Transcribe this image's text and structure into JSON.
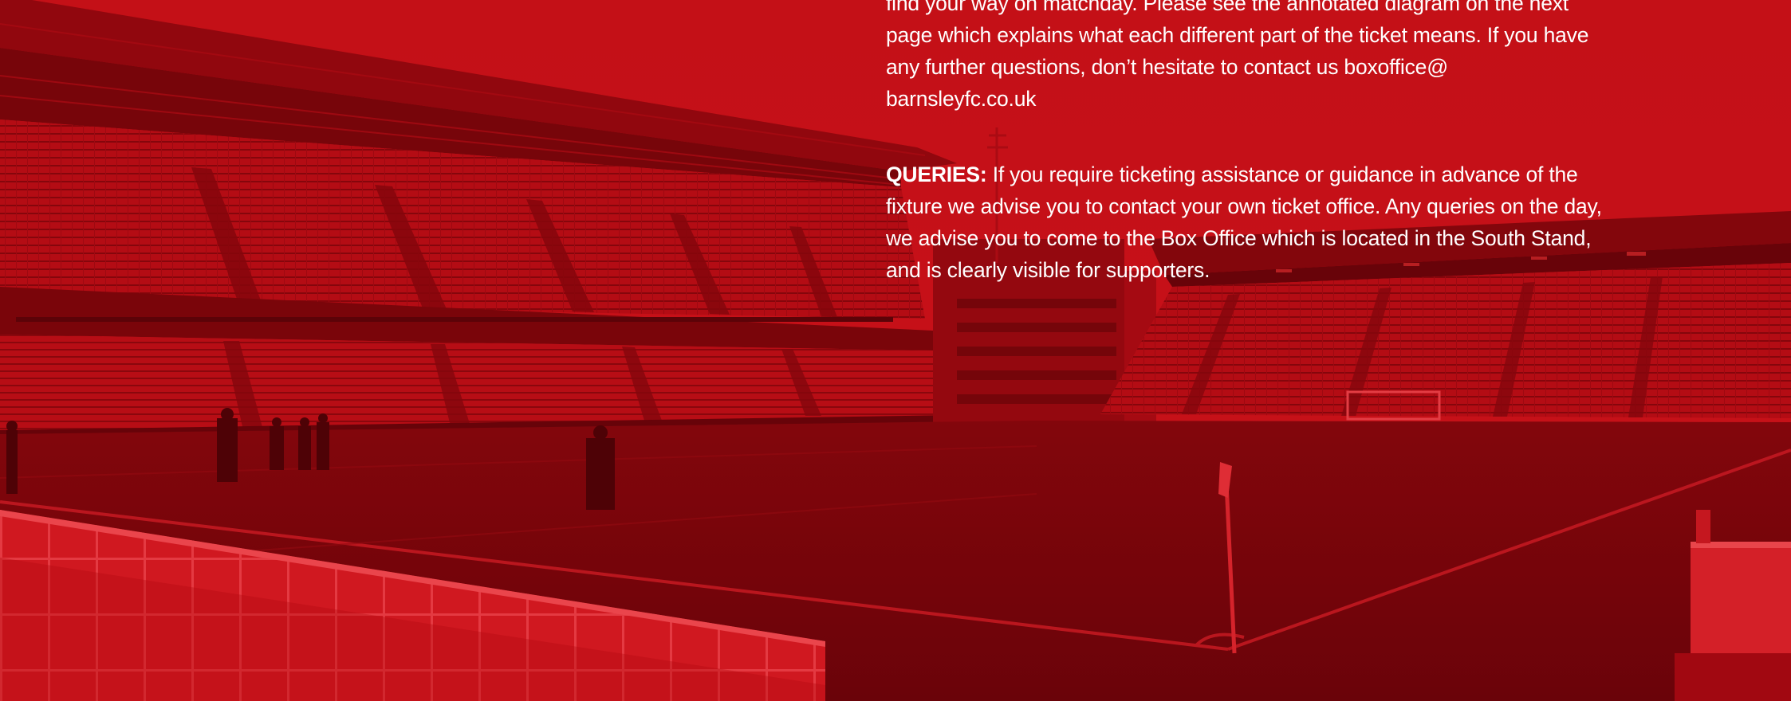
{
  "intro_paragraph": "find your way on matchday. Please see the annotated diagram on the next page which explains what each different part of the ticket means. If you have any further questions, don’t hesitate to contact us boxoffice@ barnsleyfc.co.uk",
  "queries": {
    "label": "QUERIES:",
    "text": "If you require ticketing assistance or guidance in advance of the fixture we advise you to contact your own ticket office. Any queries on the day, we advise you to come to the Box Office which is located in the South Stand, and is clearly visible for supporters."
  },
  "colors": {
    "overlay_red": "#c8101a",
    "pitch_red": "#6c0208",
    "text": "#ffffff"
  }
}
